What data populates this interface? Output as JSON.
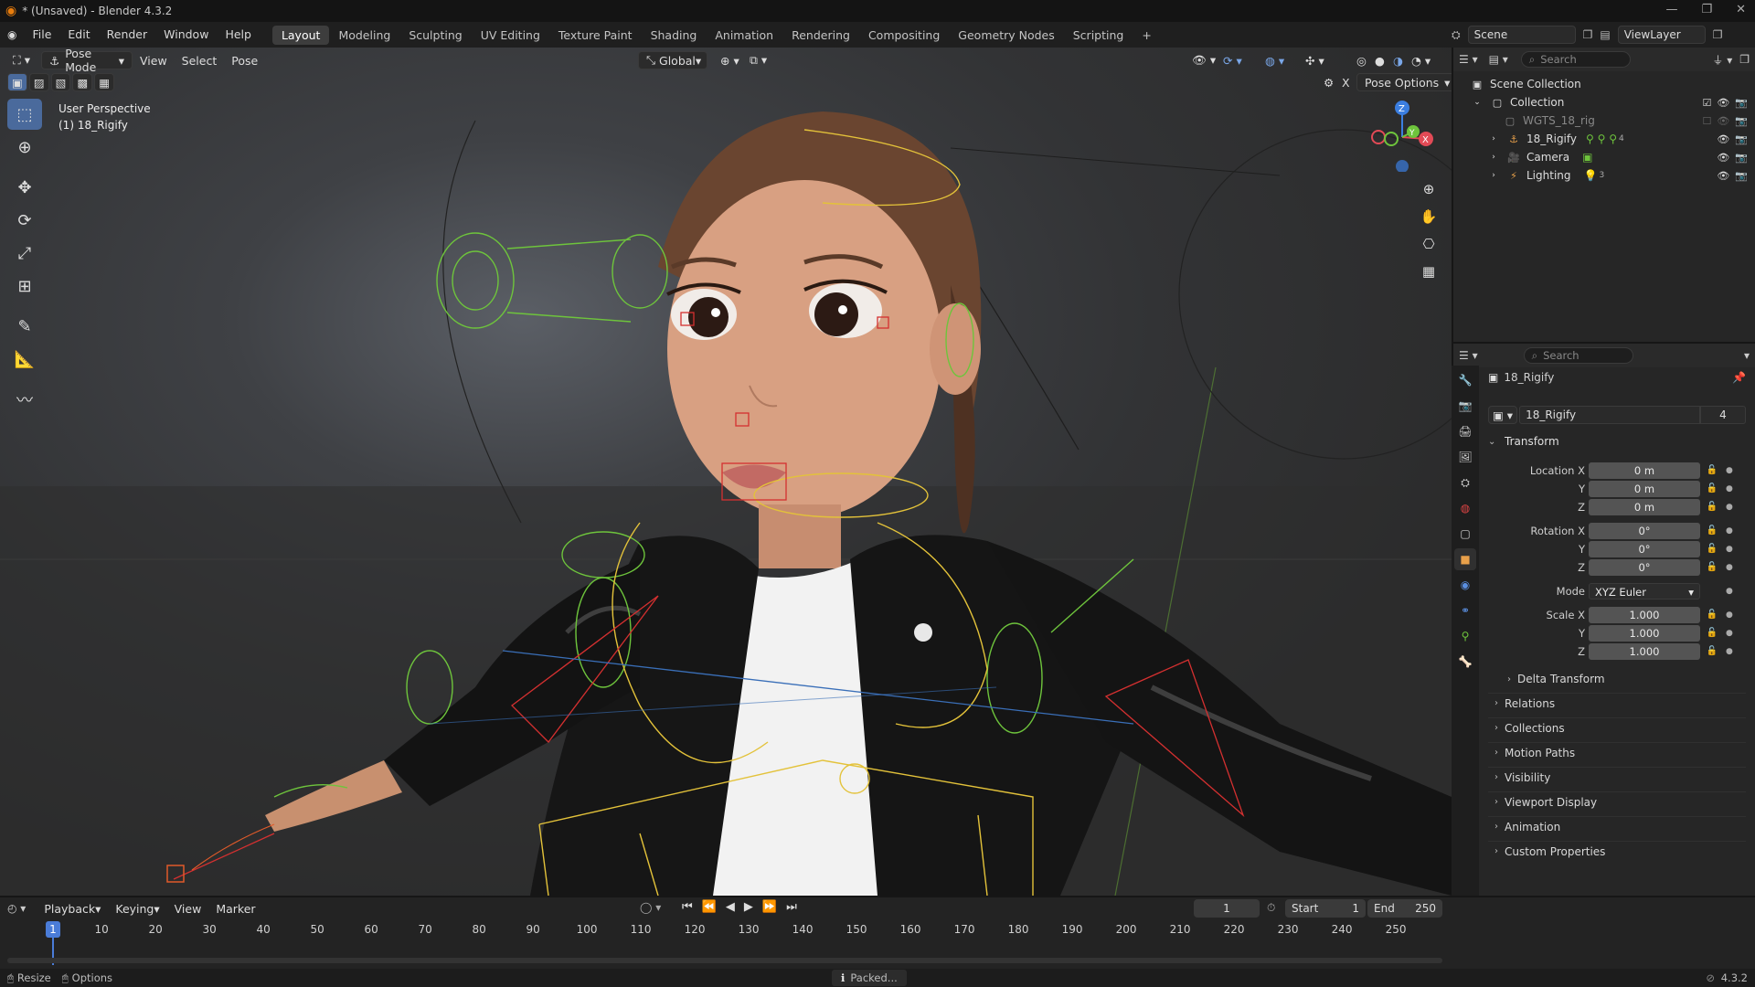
{
  "window": {
    "title": "* (Unsaved) - Blender 4.3.2"
  },
  "menu": [
    "File",
    "Edit",
    "Render",
    "Window",
    "Help"
  ],
  "workspaces": [
    "Layout",
    "Modeling",
    "Sculpting",
    "UV Editing",
    "Texture Paint",
    "Shading",
    "Animation",
    "Rendering",
    "Compositing",
    "Geometry Nodes",
    "Scripting"
  ],
  "active_workspace": "Layout",
  "scene": {
    "name": "Scene",
    "view_layer": "ViewLayer"
  },
  "viewport": {
    "mode": "Pose Mode",
    "menus": [
      "View",
      "Select",
      "Pose"
    ],
    "orientation": "Global",
    "pose_options": "Pose Options",
    "perspective": "User Perspective",
    "object_label": "(1) 18_Rigify",
    "gizmo_axes": {
      "x": "X",
      "y": "Y",
      "z": "Z"
    },
    "tools": [
      "select-box-icon",
      "cursor-icon",
      "move-icon",
      "rotate-icon",
      "scale-icon",
      "transform-icon",
      "annotate-icon",
      "measure-icon",
      "relax-icon"
    ]
  },
  "outliner": {
    "search_placeholder": "Search",
    "items": [
      {
        "label": "Scene Collection",
        "level": 0,
        "icon": "scene-collection-icon"
      },
      {
        "label": "Collection",
        "level": 1,
        "icon": "collection-icon"
      },
      {
        "label": "WGTS_18_rig",
        "level": 2,
        "icon": "collection-icon"
      },
      {
        "label": "18_Rigify",
        "level": 2,
        "icon": "armature-icon",
        "extra": "4"
      },
      {
        "label": "Camera",
        "level": 2,
        "icon": "camera-icon"
      },
      {
        "label": "Lighting",
        "level": 2,
        "icon": "light-icon",
        "extra": "3"
      }
    ]
  },
  "properties": {
    "search_placeholder": "Search",
    "object_name": "18_Rigify",
    "data_name": "18_Rigify",
    "users": "4",
    "transform": {
      "title": "Transform",
      "location_label": "Location X",
      "location": [
        "0 m",
        "0 m",
        "0 m"
      ],
      "rotation_label": "Rotation X",
      "rotation": [
        "0°",
        "0°",
        "0°"
      ],
      "mode_label": "Mode",
      "mode": "XYZ Euler",
      "scale_label": "Scale X",
      "scale": [
        "1.000",
        "1.000",
        "1.000"
      ],
      "y": "Y",
      "z": "Z"
    },
    "delta": "Delta Transform",
    "panels": [
      "Relations",
      "Collections",
      "Motion Paths",
      "Visibility",
      "Viewport Display",
      "Animation",
      "Custom Properties"
    ]
  },
  "timeline": {
    "menus": [
      "Playback",
      "Keying",
      "View",
      "Marker"
    ],
    "current_frame": "1",
    "start_label": "Start",
    "start": "1",
    "end_label": "End",
    "end": "250",
    "ticks": [
      "1",
      "10",
      "20",
      "30",
      "40",
      "50",
      "60",
      "70",
      "80",
      "90",
      "100",
      "110",
      "120",
      "130",
      "140",
      "150",
      "160",
      "170",
      "180",
      "190",
      "200",
      "210",
      "220",
      "230",
      "240",
      "250"
    ]
  },
  "status": {
    "left1": "Resize",
    "left2": "Options",
    "center": "Packed...",
    "version": "4.3.2"
  }
}
